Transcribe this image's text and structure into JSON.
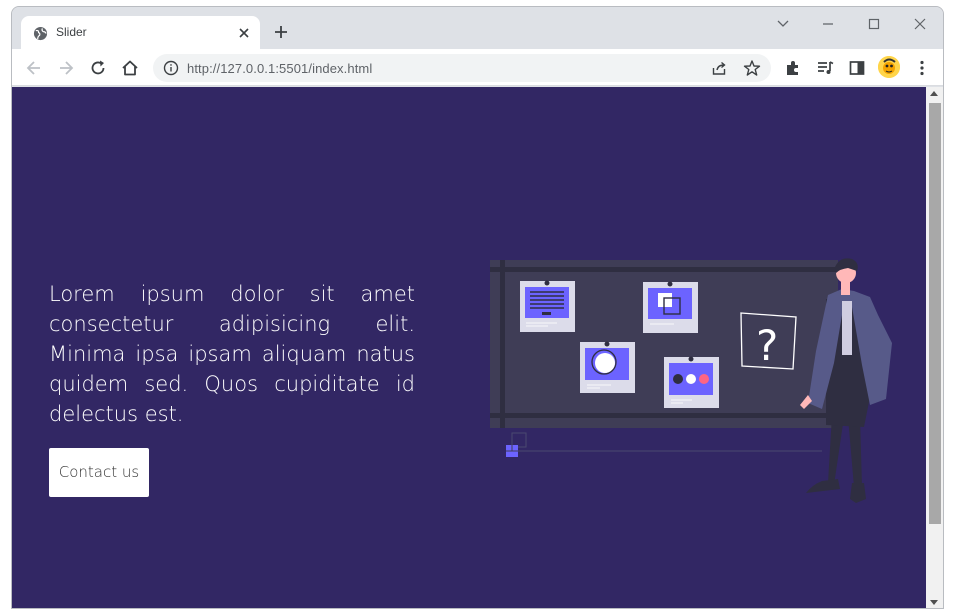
{
  "browser": {
    "tab_title": "Slider",
    "url": "http://127.0.0.1:5501/index.html"
  },
  "page": {
    "hero_text": "Lorem ipsum dolor sit amet consectetur adipisicing elit. Minima ipsa ipsam aliquam natus quidem sed. Quos cupiditate id delectus est.",
    "contact_button": "Contact us",
    "illustration_question_mark": "?"
  },
  "colors": {
    "page_background": "#322764",
    "accent": "#6c63ff",
    "board": "#3f3d56"
  },
  "icons": {
    "tab_favicon": "globe-icon",
    "toolbar": [
      "back-icon",
      "forward-icon",
      "reload-icon",
      "home-icon",
      "info-icon",
      "share-icon",
      "star-icon",
      "extensions-icon",
      "media-icon",
      "side-panel-icon",
      "avatar",
      "menu-icon"
    ]
  }
}
